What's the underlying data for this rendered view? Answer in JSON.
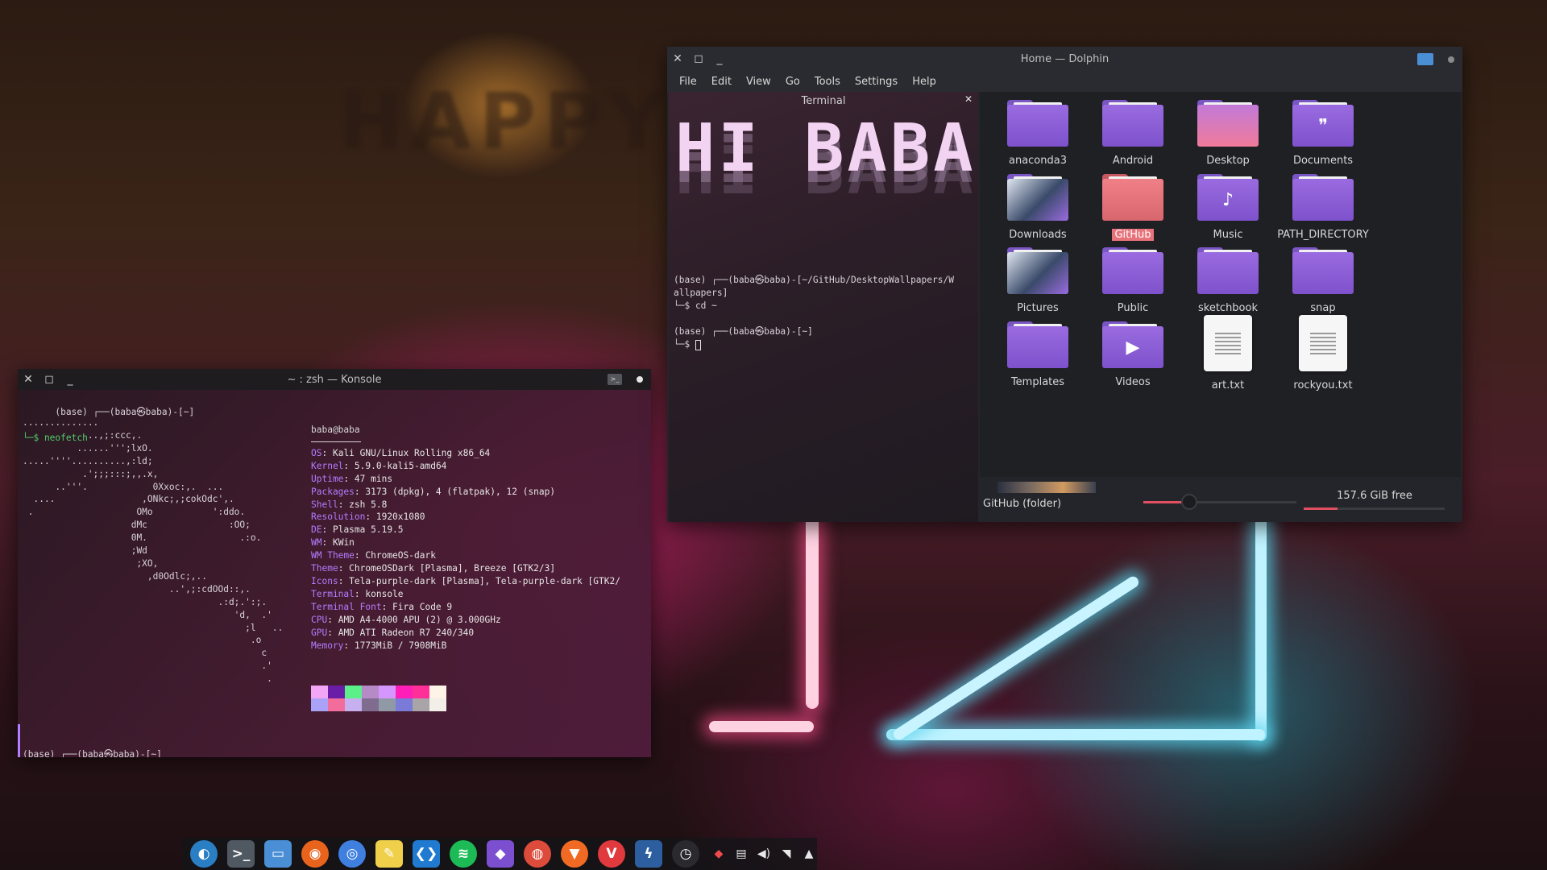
{
  "wallpaper": {
    "wall_text": "HAPPY"
  },
  "konsole": {
    "title": "~ : zsh — Konsole",
    "controls": {
      "close": "✕",
      "maximize": "◻",
      "minimize": "_"
    },
    "prompt_line_1": "(base) ┌──(baba㉿baba)-[~]",
    "command_line": "└─$ neofetch",
    "ascii_art": "..............\n            ..,;:ccc,.\n          ......''';lxO.\n.....''''..........,:ld;\n           .';;;:::;,,.x,\n      ..'''.            0Xxoc:,.  ...\n  ....                ,ONkc;,;cokOdc',.\n .                   OMo           ':ddo.\n                    dMc               :OO;\n                    0M.                 .:o.\n                    ;Wd\n                     ;XO,\n                       ,d0Odlc;,..\n                           ..',;:cdOOd::,.\n                                    .:d;.':;.\n                                       'd,  .'\n                                         ;l   ..\n                                          .o\n                                            c\n                                            .'\n                                             .",
    "user_host": "baba@baba",
    "info": [
      {
        "key": "OS",
        "value": "Kali GNU/Linux Rolling x86_64"
      },
      {
        "key": "Kernel",
        "value": "5.9.0-kali5-amd64"
      },
      {
        "key": "Uptime",
        "value": "47 mins"
      },
      {
        "key": "Packages",
        "value": "3173 (dpkg), 4 (flatpak), 12 (snap)"
      },
      {
        "key": "Shell",
        "value": "zsh 5.8"
      },
      {
        "key": "Resolution",
        "value": "1920x1080"
      },
      {
        "key": "DE",
        "value": "Plasma 5.19.5"
      },
      {
        "key": "WM",
        "value": "KWin"
      },
      {
        "key": "WM Theme",
        "value": "ChromeOS-dark"
      },
      {
        "key": "Theme",
        "value": "ChromeOSDark [Plasma], Breeze [GTK2/3]"
      },
      {
        "key": "Icons",
        "value": "Tela-purple-dark [Plasma], Tela-purple-dark [GTK2/"
      },
      {
        "key": "Terminal",
        "value": "konsole"
      },
      {
        "key": "Terminal Font",
        "value": "Fira Code 9"
      },
      {
        "key": "CPU",
        "value": "AMD A4-4000 APU (2) @ 3.000GHz"
      },
      {
        "key": "GPU",
        "value": "AMD ATI Radeon R7 240/340"
      },
      {
        "key": "Memory",
        "value": "1773MiB / 7908MiB"
      }
    ],
    "swatch_colors": [
      "#f4a6f6",
      "#6a1ea8",
      "#5cf08a",
      "#b58ac7",
      "#d596ff",
      "#ff1fb8",
      "#ff2f9a",
      "#fdf3e6",
      "#a9a2f6",
      "#f26d9c",
      "#c7b0f0",
      "#7f6c8f",
      "#8f9aa6",
      "#7a7ad8",
      "#a8a4a8",
      "#f2efe8"
    ],
    "prompt_bottom": "(base) ┌──(baba㉿baba)-[~]",
    "prompt_bottom_2": "└─$ "
  },
  "dolphin": {
    "title": "Home — Dolphin",
    "controls": {
      "close": "✕",
      "maximize": "◻",
      "minimize": "_"
    },
    "menu": [
      "File",
      "Edit",
      "View",
      "Go",
      "Tools",
      "Settings",
      "Help"
    ],
    "terminal_panel": {
      "header": "Terminal",
      "banner": "HI BABA",
      "line1": "(base) ┌──(baba㉿baba)-[~/GitHub/DesktopWallpapers/W",
      "line2": "allpapers]",
      "line3": "└─$ cd ~",
      "line4": "(base) ┌──(baba㉿baba)-[~]",
      "line5": "└─$ "
    },
    "files": [
      {
        "name": "anaconda3",
        "type": "folder",
        "glyph": ""
      },
      {
        "name": "Android",
        "type": "folder",
        "glyph": ""
      },
      {
        "name": "Desktop",
        "type": "desktop",
        "glyph": ""
      },
      {
        "name": "Documents",
        "type": "folder",
        "glyph": "❞"
      },
      {
        "name": "Downloads",
        "type": "images",
        "glyph": ""
      },
      {
        "name": "GitHub",
        "type": "folder-red",
        "glyph": ""
      },
      {
        "name": "Music",
        "type": "folder",
        "glyph": "♪"
      },
      {
        "name": "PATH_DIRECTORY",
        "type": "folder",
        "glyph": ""
      },
      {
        "name": "Pictures",
        "type": "images",
        "glyph": ""
      },
      {
        "name": "Public",
        "type": "folder",
        "glyph": ""
      },
      {
        "name": "sketchbook",
        "type": "folder",
        "glyph": ""
      },
      {
        "name": "snap",
        "type": "folder",
        "glyph": ""
      },
      {
        "name": "Templates",
        "type": "folder",
        "glyph": ""
      },
      {
        "name": "Videos",
        "type": "folder",
        "glyph": "▶"
      },
      {
        "name": "art.txt",
        "type": "text",
        "glyph": ""
      },
      {
        "name": "rockyou.txt",
        "type": "text",
        "glyph": ""
      }
    ],
    "selected_file": "GitHub",
    "status": "GitHub (folder)",
    "free_space": "157.6 GiB free",
    "zoom_fraction": 0.3,
    "used_fraction": 0.24
  },
  "dock": {
    "apps": [
      {
        "name": "kde-launcher-icon",
        "glyph": "◐",
        "color": "#2a7fc4",
        "shape": "circle"
      },
      {
        "name": "konsole-icon",
        "glyph": ">_",
        "color": "#505862",
        "shape": "square"
      },
      {
        "name": "dolphin-files-icon",
        "glyph": "▭",
        "color": "#4a8fd6",
        "shape": "square"
      },
      {
        "name": "firefox-icon",
        "glyph": "◉",
        "color": "#e8641c",
        "shape": "circle"
      },
      {
        "name": "chromium-icon",
        "glyph": "◎",
        "color": "#3f7fe0",
        "shape": "circle"
      },
      {
        "name": "text-editor-icon",
        "glyph": "✎",
        "color": "#f0d04a",
        "shape": "square"
      },
      {
        "name": "vscode-icon",
        "glyph": "❮❯",
        "color": "#1f7ad0",
        "shape": "square"
      },
      {
        "name": "spotify-icon",
        "glyph": "≋",
        "color": "#1dbb55",
        "shape": "circle"
      },
      {
        "name": "obsidian-icon",
        "glyph": "◆",
        "color": "#7b4fd0",
        "shape": "square"
      },
      {
        "name": "chrome-icon",
        "glyph": "◍",
        "color": "#dd4b3a",
        "shape": "circle"
      },
      {
        "name": "brave-icon",
        "glyph": "▼",
        "color": "#f06a23",
        "shape": "circle"
      },
      {
        "name": "vivaldi-icon",
        "glyph": "V",
        "color": "#e03a3e",
        "shape": "circle"
      },
      {
        "name": "kali-dragon-icon",
        "glyph": "ϟ",
        "color": "#2d5fa0",
        "shape": "square"
      },
      {
        "name": "clock-icon",
        "glyph": "◷",
        "color": "#2a2a2e",
        "shape": "circle"
      }
    ],
    "tray": [
      {
        "name": "anydesk-tray-icon",
        "glyph": "◆"
      },
      {
        "name": "clipboard-tray-icon",
        "glyph": "▤"
      },
      {
        "name": "volume-tray-icon",
        "glyph": "◀)"
      },
      {
        "name": "wifi-tray-icon",
        "glyph": "◥"
      },
      {
        "name": "tray-expand-icon",
        "glyph": "▲"
      }
    ]
  }
}
